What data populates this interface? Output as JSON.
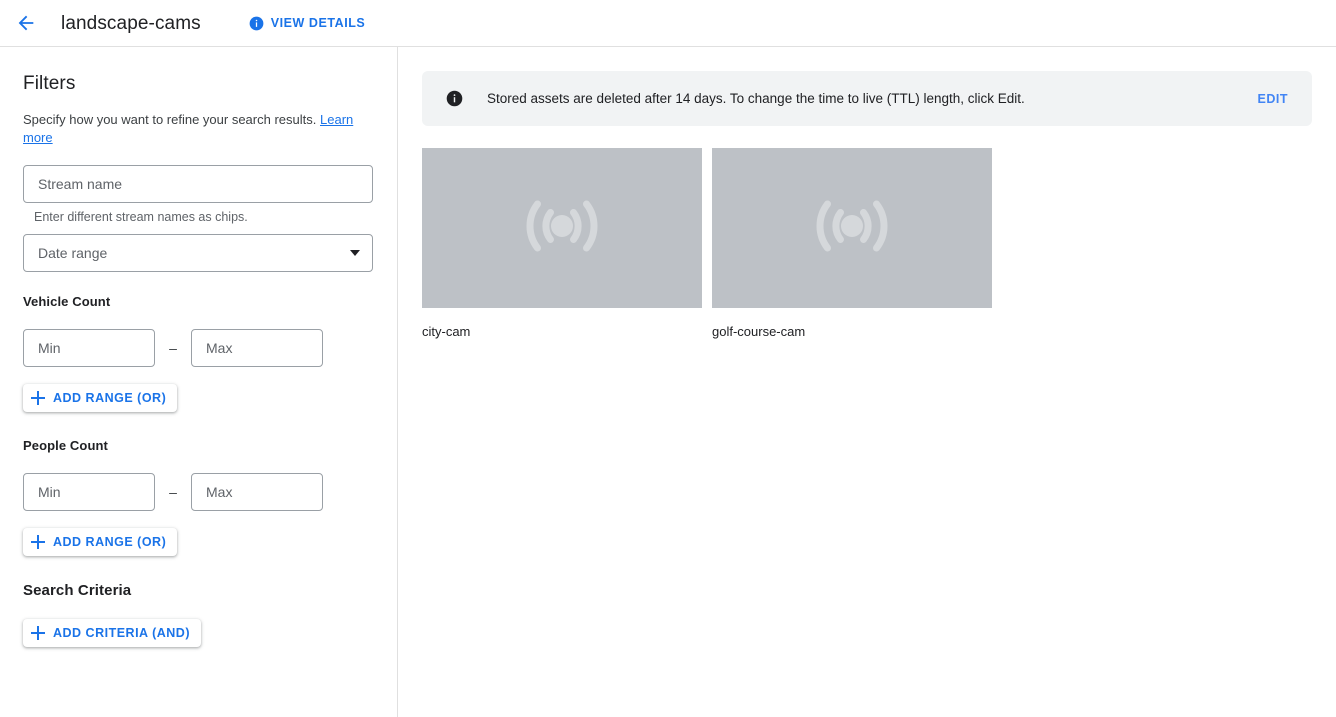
{
  "header": {
    "back_icon": "arrow-back-icon",
    "title": "landscape-cams",
    "view_details_label": "VIEW DETAILS",
    "view_details_icon": "info-icon"
  },
  "sidebar": {
    "title": "Filters",
    "description": "Specify how you want to refine your search results.",
    "learn_more_label": "Learn more",
    "stream_name": {
      "placeholder": "Stream name",
      "helper": "Enter different stream names as chips."
    },
    "date_range": {
      "label": "Date range",
      "caret_icon": "chevron-down-icon"
    },
    "vehicle_count": {
      "label": "Vehicle Count",
      "min_placeholder": "Min",
      "max_placeholder": "Max",
      "dash": "–",
      "add_range_label": "ADD RANGE (OR)",
      "add_icon": "plus-icon"
    },
    "people_count": {
      "label": "People Count",
      "min_placeholder": "Min",
      "max_placeholder": "Max",
      "dash": "–",
      "add_range_label": "ADD RANGE (OR)",
      "add_icon": "plus-icon"
    },
    "search_criteria": {
      "label": "Search Criteria",
      "add_criteria_label": "ADD CRITERIA (AND)",
      "add_icon": "plus-icon"
    }
  },
  "main": {
    "banner": {
      "icon": "info-icon",
      "text": "Stored assets are deleted after 14 days. To change the time to live (TTL) length, click Edit.",
      "action_label": "EDIT"
    },
    "cards": [
      {
        "label": "city-cam",
        "thumb_icon": "broadcast-stream-icon"
      },
      {
        "label": "golf-course-cam",
        "thumb_icon": "broadcast-stream-icon"
      }
    ]
  },
  "colors": {
    "accent_blue": "#1a73e8",
    "link_blue": "#4285f4",
    "banner_bg": "#f1f3f4",
    "thumb_bg": "#bdc1c6",
    "border": "#9aa0a6"
  }
}
